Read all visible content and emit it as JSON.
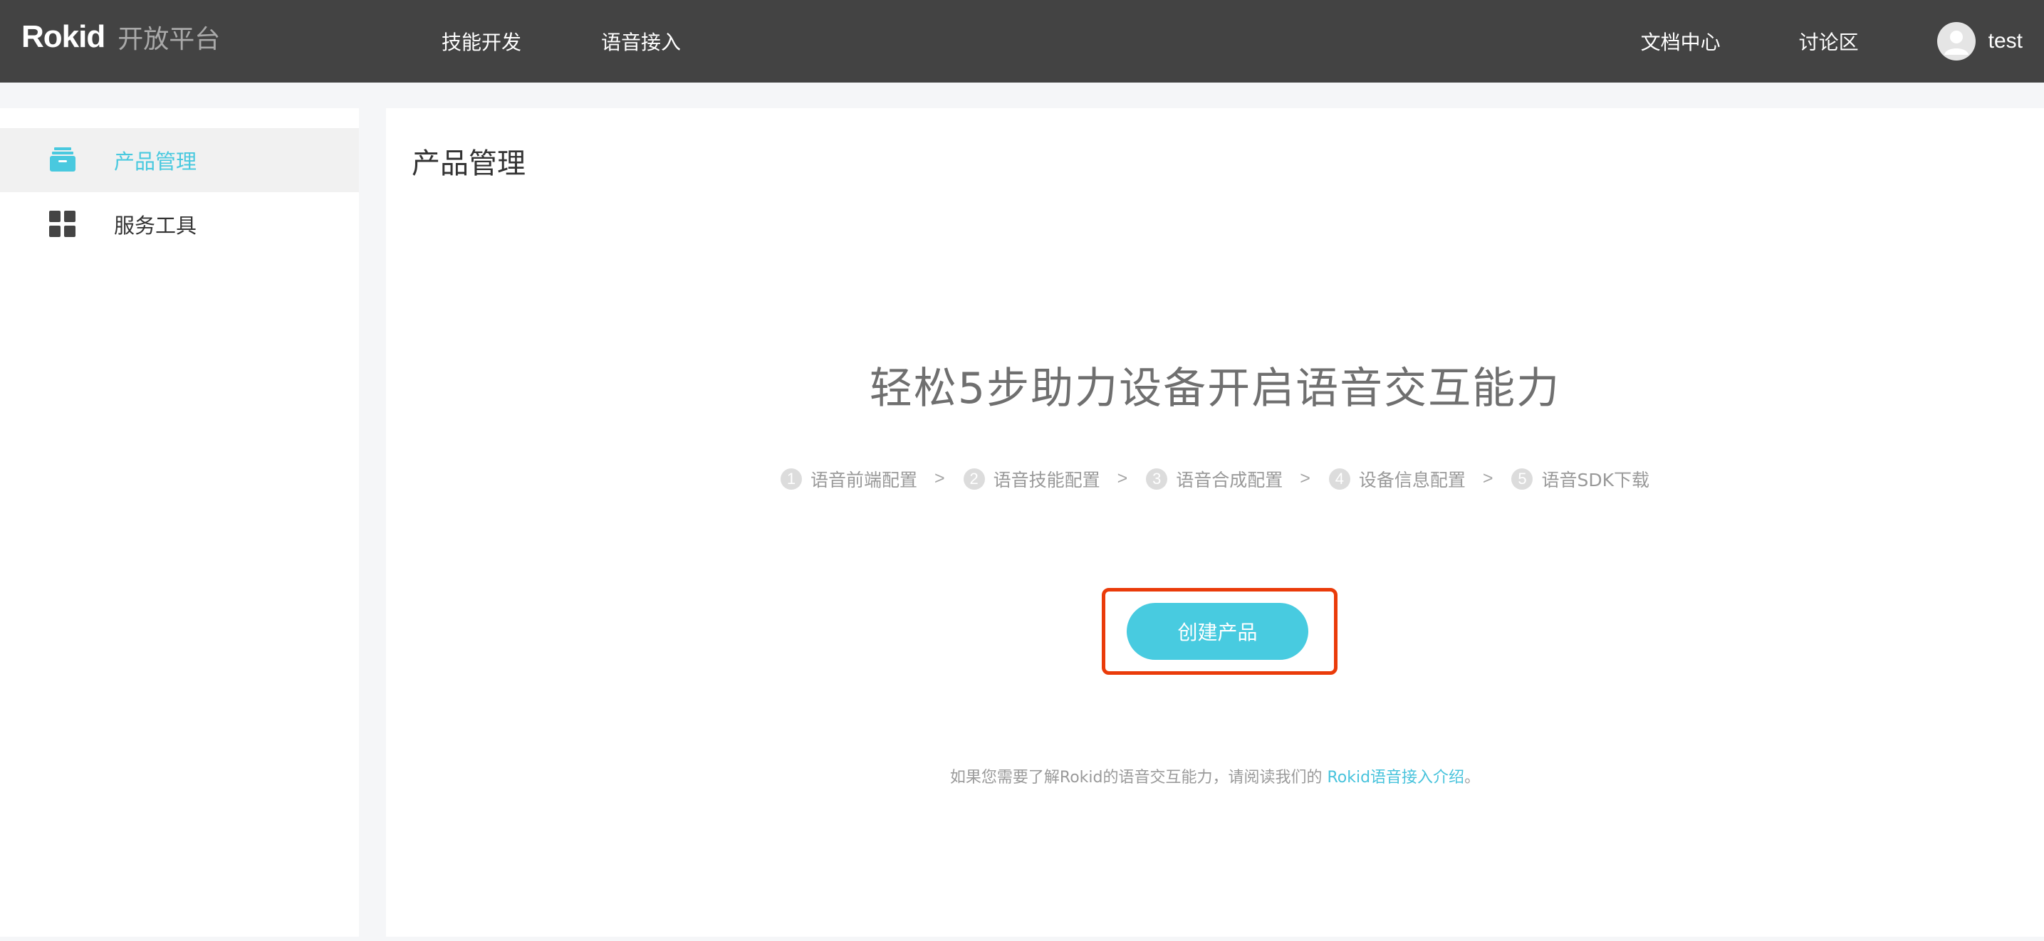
{
  "header": {
    "logo_text": "Rokid",
    "logo_sub": "开放平台",
    "nav_left": [
      {
        "label": "技能开发"
      },
      {
        "label": "语音接入"
      }
    ],
    "nav_right": [
      {
        "label": "文档中心"
      },
      {
        "label": "讨论区"
      }
    ],
    "user": {
      "name": "test",
      "avatar_icon": "user-avatar-icon"
    }
  },
  "sidebar": {
    "items": [
      {
        "label": "产品管理",
        "icon": "product-box-icon",
        "active": true
      },
      {
        "label": "服务工具",
        "icon": "grid-apps-icon",
        "active": false
      }
    ]
  },
  "main": {
    "title": "产品管理",
    "hero": "轻松5步助力设备开启语音交互能力",
    "steps": [
      {
        "num": "1",
        "label": "语音前端配置"
      },
      {
        "num": "2",
        "label": "语音技能配置"
      },
      {
        "num": "3",
        "label": "语音合成配置"
      },
      {
        "num": "4",
        "label": "设备信息配置"
      },
      {
        "num": "5",
        "label": "语音SDK下载"
      }
    ],
    "step_separator": ">",
    "create_button": "创建产品",
    "footnote_text": "如果您需要了解Rokid的语音交互能力，请阅读我们的 ",
    "footnote_link": "Rokid语音接入介绍",
    "footnote_end": "。"
  },
  "colors": {
    "header_bg": "#434343",
    "accent": "#48cbe0",
    "highlight": "#ea3b0a",
    "page_bg": "#f5f6f8"
  }
}
